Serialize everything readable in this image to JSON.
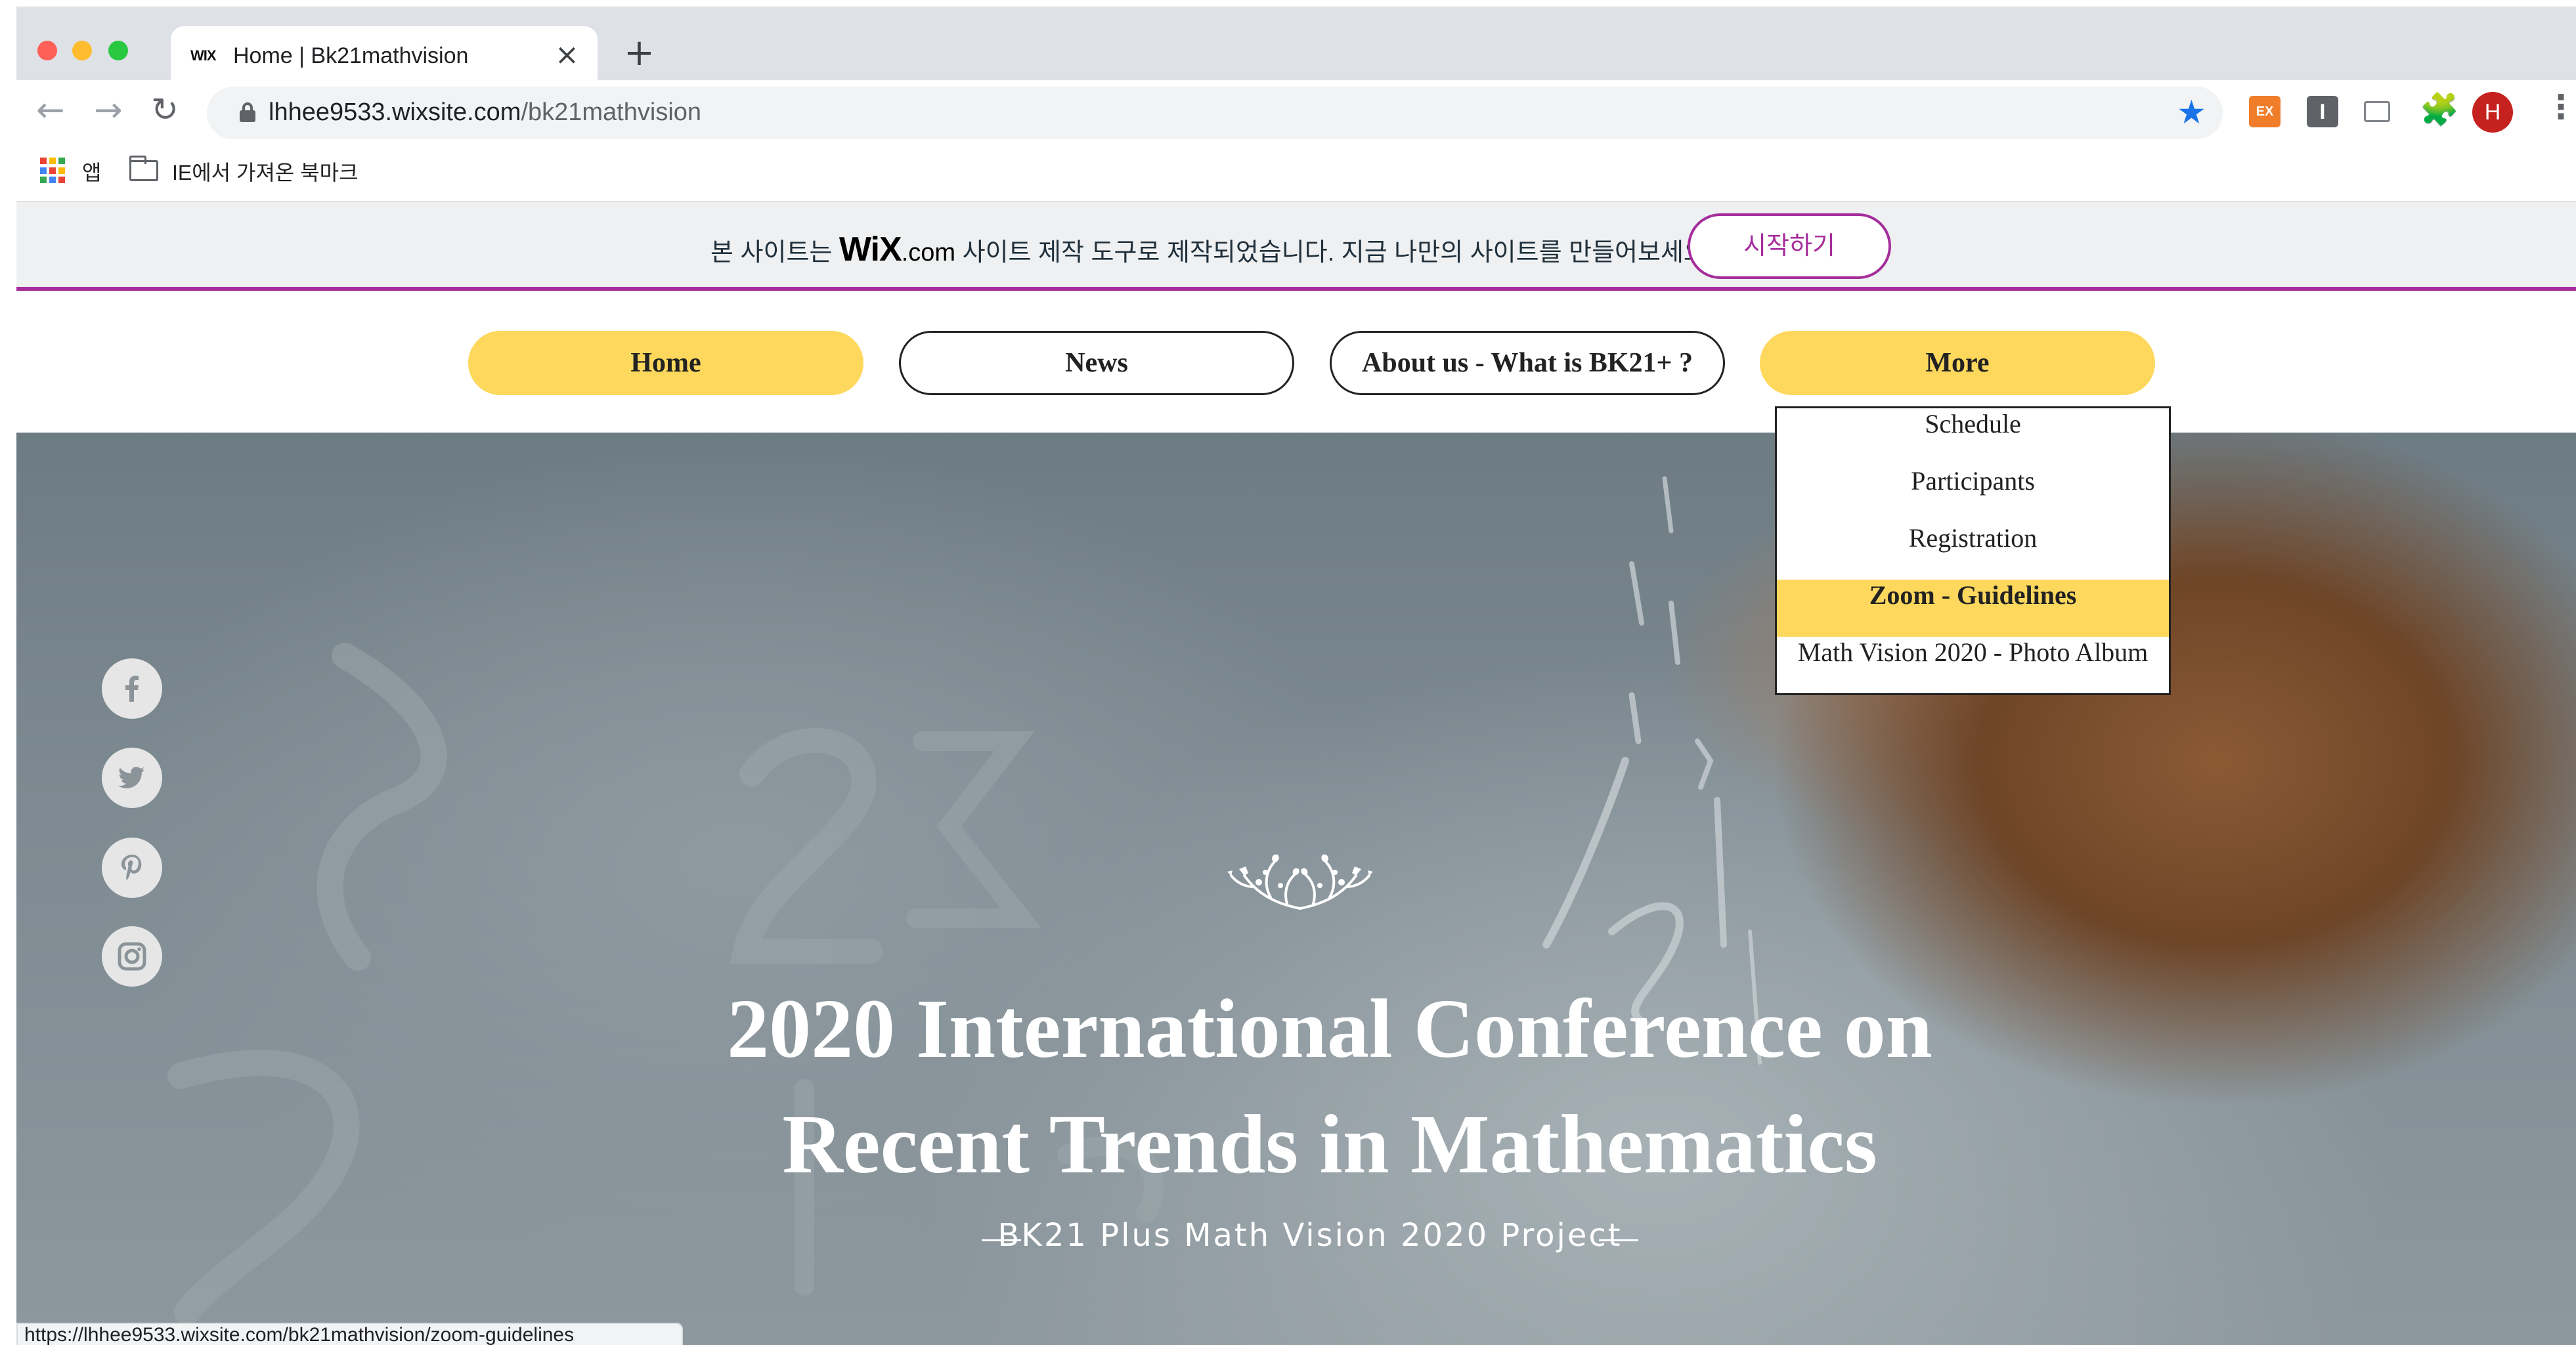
{
  "browser": {
    "tab_favicon": "WIX",
    "tab_title": "Home | Bk21mathvision",
    "tab_close": "×",
    "new_tab": "+",
    "url_host": "lhhee9533.wixsite.com",
    "url_path": "/bk21mathvision",
    "ext_ex_label": "EX",
    "ext_i_label": "I",
    "profile_initial": "H",
    "bookmarks": {
      "apps_label": "앱",
      "folder_label": "IE에서 가져온 북마크"
    },
    "status_url": "https://lhhee9533.wixsite.com/bk21mathvision/zoom-guidelines"
  },
  "wix_banner": {
    "text_before": "본 사이트는",
    "logo_main": "WiX",
    "logo_suffix": ".com",
    "text_after": "사이트 제작 도구로 제작되었습니다. 지금 나만의 사이트를 만들어보세요.",
    "start_button": "시작하기",
    "accent_color": "#a52d9c"
  },
  "site_nav": {
    "items": [
      {
        "label": "Home"
      },
      {
        "label": "News"
      },
      {
        "label": "About us - What is BK21+ ?"
      },
      {
        "label": "More"
      }
    ],
    "highlight_color": "#fdd85d"
  },
  "dropdown": {
    "items": [
      {
        "label": "Schedule"
      },
      {
        "label": "Participants"
      },
      {
        "label": "Registration"
      },
      {
        "label": "Zoom - Guidelines"
      },
      {
        "label": "Math Vision 2020 - Photo Album"
      }
    ]
  },
  "social": [
    "facebook-icon",
    "twitter-icon",
    "pinterest-icon",
    "instagram-icon"
  ],
  "hero": {
    "title_line1": "2020 International Conference on",
    "title_line2": "Recent Trends in Mathematics",
    "subtitle": "BK21 Plus Math Vision 2020 Project"
  }
}
